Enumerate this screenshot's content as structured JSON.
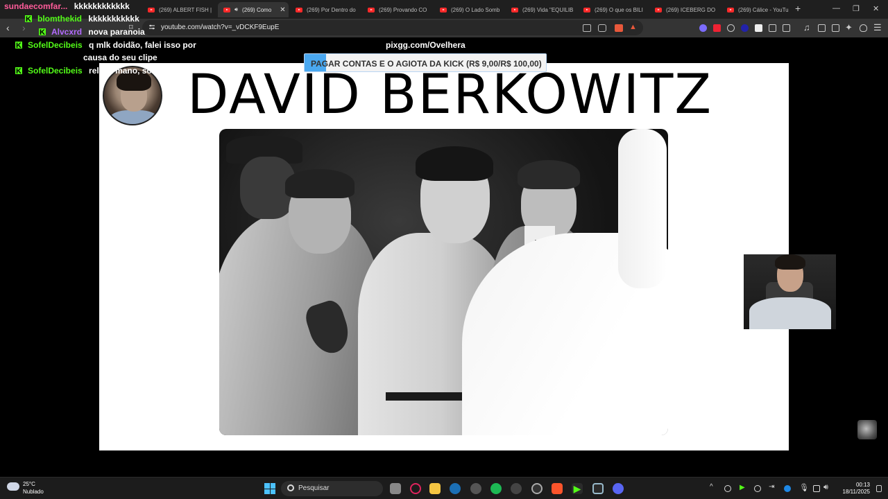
{
  "browser": {
    "tabs": [
      {
        "label": "(269) ALBERT FISH |"
      },
      {
        "label": "(269) Como",
        "active": true
      },
      {
        "label": "(269) Por Dentro do"
      },
      {
        "label": "(269) Provando CO"
      },
      {
        "label": "(269) O Lado Somb"
      },
      {
        "label": "(269) Vida \"EQUILIB"
      },
      {
        "label": "(269) O que os BILI"
      },
      {
        "label": "(269) ICEBERG DO"
      },
      {
        "label": "(269) Cálice - YouTu"
      }
    ],
    "url": "youtube.com/watch?v=_vDCKF9EupE"
  },
  "stream": {
    "pix_label": "pixgg.com/Ovelhera",
    "donation_goal": {
      "text": "PAGAR CONTAS E O AGIOTA DA KICK (R$ 9,00/R$ 100,00)",
      "current": 9,
      "target": 100
    }
  },
  "chat": [
    {
      "user": "sundaecomfar...",
      "message": "kkkkkkkkkkkk",
      "color": "#ff5c9a"
    },
    {
      "user": "blomthekid",
      "message": "kkkkkkkkkkk",
      "color": "#53fc18"
    },
    {
      "user": "Alvcxrd",
      "message": "nova paranoia",
      "color": "#b36bff"
    },
    {
      "user": "SofelDecibeis",
      "message_line1": "q mlk doidão, falei isso por",
      "message_line2": "causa do seu clipe",
      "color": "#53fc18"
    },
    {
      "user": "SofelDecibeis",
      "message": "relaxa mano, só fala baixo",
      "color": "#53fc18"
    }
  ],
  "slide": {
    "title": "DAVID BERKOWITZ"
  },
  "taskbar": {
    "weather_temp": "25°C",
    "weather_condition": "Nublado",
    "search_label": "Pesquisar",
    "time": "00:13",
    "date": "18/11/2025"
  },
  "colors": {
    "kick_green": "#53fc18",
    "progress_blue": "#4aa8f0",
    "youtube_red": "#ff2a2a"
  }
}
